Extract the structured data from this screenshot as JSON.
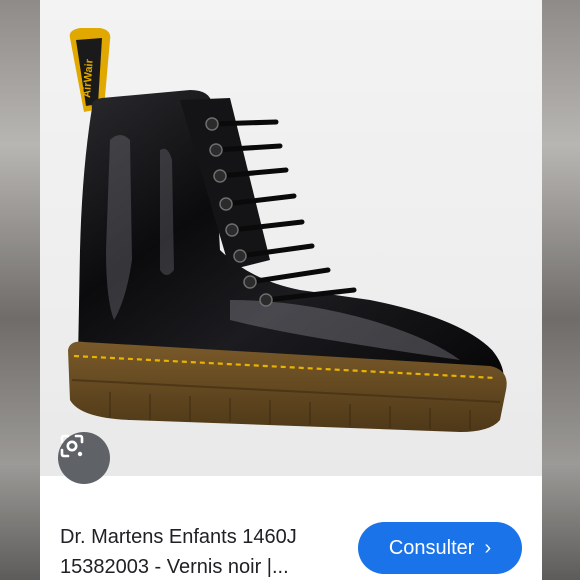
{
  "result": {
    "title_line1": "Dr. Martens Enfants 1460J",
    "title_line2": "15382003 - Vernis noir |...",
    "button_label": "Consulter",
    "button_chevron": "›",
    "lens_icon": "google-lens-icon",
    "pull_tab_text": "AirWair"
  },
  "colors": {
    "button_bg": "#1a73e8",
    "lens_bg": "#5f6368",
    "title_text": "#202124",
    "boot_leather": "#0d0d0f",
    "sole": "#6b4f24",
    "stitch": "#e8b400"
  }
}
